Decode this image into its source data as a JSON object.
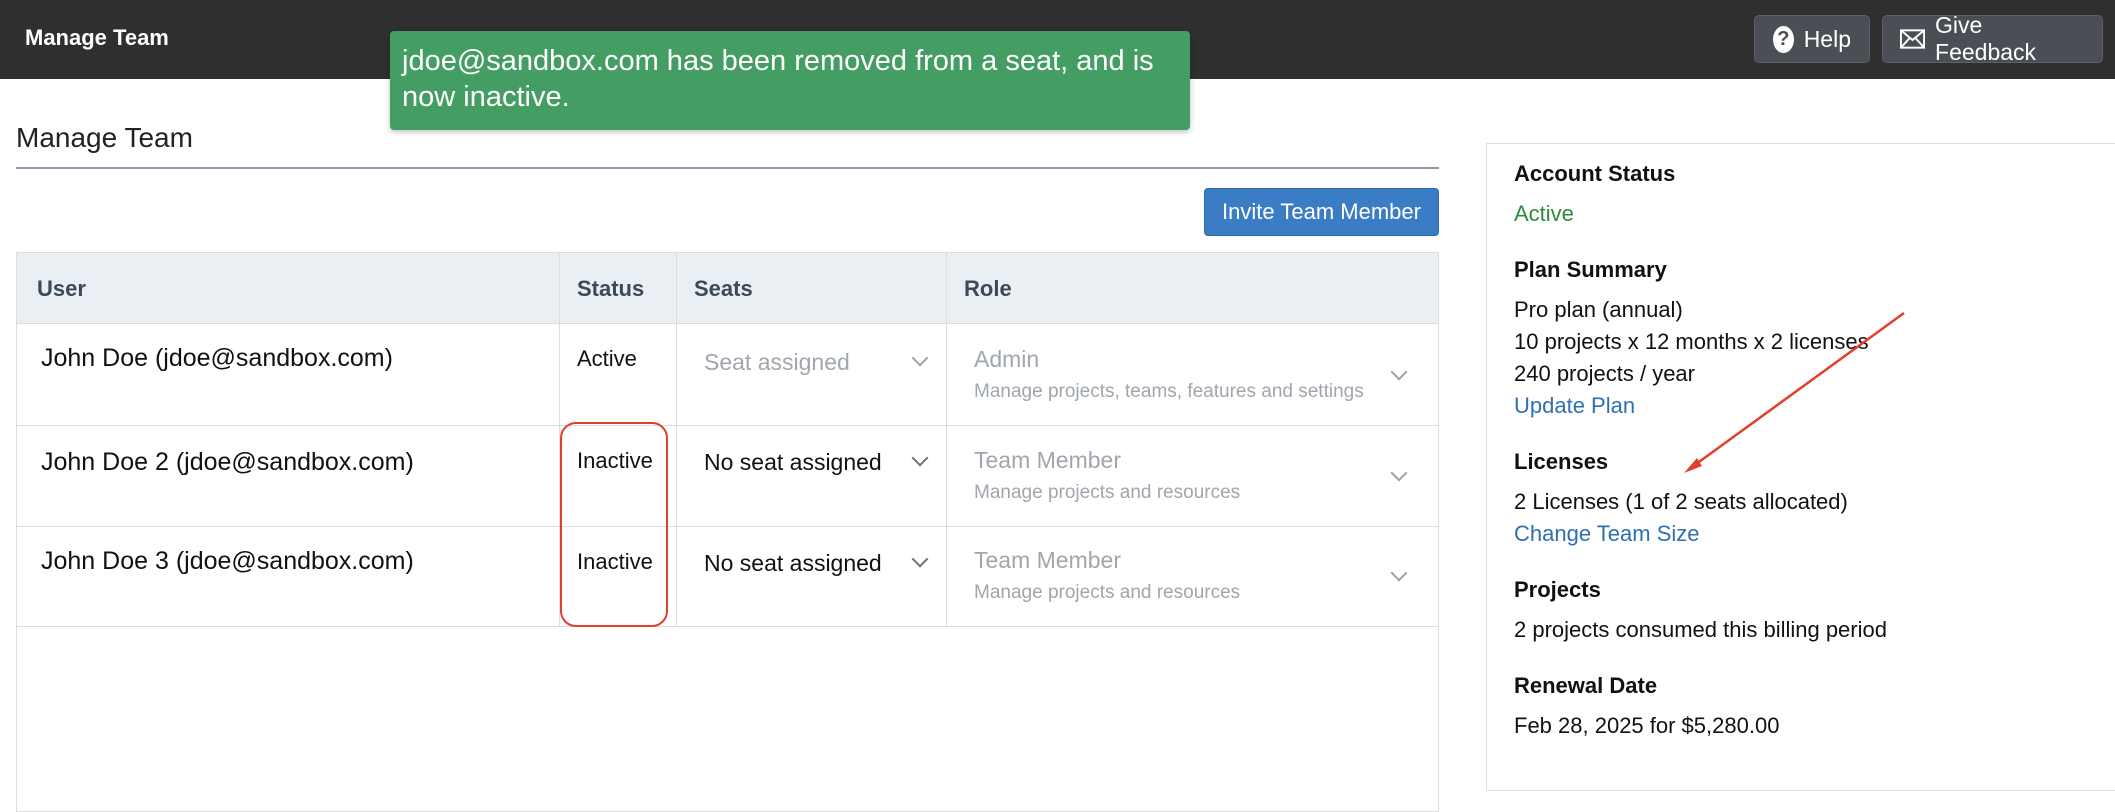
{
  "topbar": {
    "title": "Manage Team",
    "help_label": "Help",
    "feedback_label": "Give Feedback"
  },
  "toast": {
    "message": "jdoe@sandbox.com has been removed from a seat, and is now inactive."
  },
  "main": {
    "heading": "Manage Team",
    "invite_label": "Invite Team Member",
    "columns": [
      "User",
      "Status",
      "Seats",
      "Role"
    ],
    "rows": [
      {
        "user": "John Doe (jdoe@sandbox.com)",
        "status": "Active",
        "seat": "Seat assigned",
        "role": "Admin",
        "role_desc": "Manage projects, teams, features and settings"
      },
      {
        "user": "John Doe 2 (jdoe@sandbox.com)",
        "status": "Inactive",
        "seat": "No seat assigned",
        "role": "Team Member",
        "role_desc": "Manage projects and resources"
      },
      {
        "user": "John Doe 3 (jdoe@sandbox.com)",
        "status": "Inactive",
        "seat": "No seat assigned",
        "role": "Team Member",
        "role_desc": "Manage projects and resources"
      }
    ]
  },
  "side": {
    "account_status_label": "Account Status",
    "account_status": "Active",
    "plan_summary_label": "Plan Summary",
    "plan_line1": "Pro plan (annual)",
    "plan_line2": "10 projects x 12 months x 2 licenses",
    "plan_line3": "240 projects / year",
    "update_plan": "Update Plan",
    "licenses_label": "Licenses",
    "licenses_value": "2 Licenses (1 of 2 seats allocated)",
    "change_team_size": "Change Team Size",
    "projects_label": "Projects",
    "projects_value": "2 projects consumed this billing period",
    "renewal_label": "Renewal Date",
    "renewal_value": "Feb 28, 2025 for $5,280.00"
  },
  "colors": {
    "topbar": "#2f2f2f",
    "toast": "#449d62",
    "primary_button": "#3b7dc4",
    "link": "#2f6fb3",
    "active_status": "#2f8a3c",
    "annotation": "#e0402a"
  }
}
